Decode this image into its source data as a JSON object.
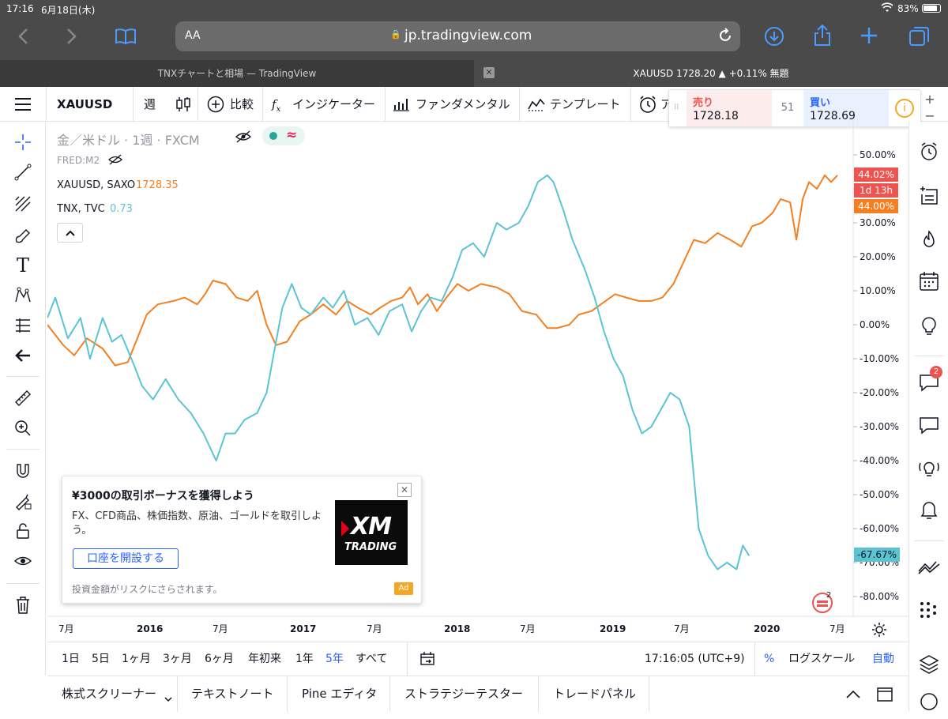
{
  "status": {
    "time": "17:16",
    "date": "6月18日(木)",
    "battery": "83%"
  },
  "browser": {
    "aa": "AA",
    "url": "jp.tradingview.com"
  },
  "tabs": [
    {
      "label": "TNXチャートと相場 — TradingView"
    },
    {
      "label": "XAUUSD 1728.20 ▲ +0.11% 無題"
    }
  ],
  "toolbar": {
    "symbol": "XAUUSD",
    "interval": "週",
    "compare": "比較",
    "indicators": "インジケーター",
    "fundamentals": "ファンダメンタル",
    "templates": "テンプレート",
    "alert": "ア"
  },
  "trade": {
    "sell_label": "売り",
    "sell_price": "1728.18",
    "spread": "51",
    "buy_label": "買い",
    "buy_price": "1728.69"
  },
  "legend": {
    "title": "金／米ドル · 1週 · FXCM",
    "fred": "FRED:M2",
    "xau_name": "XAUUSD, SAXO",
    "xau_value": "1728.35",
    "tnx_name": "TNX, TVC",
    "tnx_value": "0.73"
  },
  "badges": {
    "gold_pct": "44.02%",
    "countdown": "1d 13h",
    "gold_pct2": "44.00%",
    "tnx_pct": "-67.67%"
  },
  "ad": {
    "title": "¥3000の取引ボーナスを獲得しよう",
    "body": "FX、CFD商品、株価指数、原油、ゴールドを取引しよう。",
    "button": "口座を開設する",
    "risk": "投資金額がリスクにさらされます。",
    "tag": "Ad",
    "logo_top": "XM",
    "logo_bottom": "TRADING"
  },
  "ranges": [
    "1日",
    "5日",
    "1ヶ月",
    "3ヶ月",
    "6ヶ月",
    "年初来",
    "1年",
    "5年",
    "すべて"
  ],
  "bottom": {
    "clock": "17:16:05 (UTC+9)",
    "pct": "%",
    "log": "ログスケール",
    "auto": "自動"
  },
  "panel": [
    "株式スクリーナー",
    "テキストノート",
    "Pine エディタ",
    "ストラテジーテスター",
    "トレードパネル"
  ],
  "notif_count": "2",
  "colors": {
    "gold": "#f57f20",
    "tnx": "#5bc4d4",
    "up": "#ef5350",
    "blue": "#2962ff"
  },
  "chart_data": {
    "type": "line",
    "x_ticks": [
      "7月",
      "2016",
      "7月",
      "2017",
      "7月",
      "2018",
      "7月",
      "2019",
      "7月",
      "2020",
      "7月"
    ],
    "y_ticks": [
      "50.00%",
      "40.00%",
      "30.00%",
      "20.00%",
      "10.00%",
      "0.00%",
      "-10.00%",
      "-20.00%",
      "-30.00%",
      "-40.00%",
      "-50.00%",
      "-60.00%",
      "-70.00%",
      "-80.00%"
    ],
    "ylim": [
      -85,
      55
    ],
    "xlim": [
      2015.45,
      2020.55
    ],
    "series": [
      {
        "color": "#f57f20",
        "points": [
          [
            2015.45,
            0
          ],
          [
            2015.55,
            -6
          ],
          [
            2015.62,
            -9
          ],
          [
            2015.7,
            -4
          ],
          [
            2015.8,
            -7
          ],
          [
            2015.88,
            -12
          ],
          [
            2015.96,
            -11
          ],
          [
            2016.02,
            -4
          ],
          [
            2016.08,
            3
          ],
          [
            2016.15,
            6
          ],
          [
            2016.25,
            7
          ],
          [
            2016.32,
            8
          ],
          [
            2016.4,
            6
          ],
          [
            2016.45,
            9
          ],
          [
            2016.5,
            13
          ],
          [
            2016.58,
            12
          ],
          [
            2016.65,
            8
          ],
          [
            2016.72,
            7
          ],
          [
            2016.78,
            10
          ],
          [
            2016.84,
            0
          ],
          [
            2016.9,
            -6
          ],
          [
            2016.97,
            -5
          ],
          [
            2017.05,
            1
          ],
          [
            2017.12,
            3
          ],
          [
            2017.2,
            6
          ],
          [
            2017.28,
            3
          ],
          [
            2017.35,
            7
          ],
          [
            2017.42,
            5
          ],
          [
            2017.5,
            3
          ],
          [
            2017.56,
            5
          ],
          [
            2017.63,
            7
          ],
          [
            2017.7,
            8
          ],
          [
            2017.75,
            11
          ],
          [
            2017.8,
            6
          ],
          [
            2017.86,
            9
          ],
          [
            2017.92,
            4
          ],
          [
            2017.98,
            8
          ],
          [
            2018.05,
            12
          ],
          [
            2018.12,
            10
          ],
          [
            2018.2,
            12
          ],
          [
            2018.3,
            11
          ],
          [
            2018.38,
            9
          ],
          [
            2018.46,
            4
          ],
          [
            2018.55,
            3
          ],
          [
            2018.62,
            -1
          ],
          [
            2018.68,
            -1
          ],
          [
            2018.76,
            0
          ],
          [
            2018.82,
            3
          ],
          [
            2018.9,
            4
          ],
          [
            2018.96,
            6
          ],
          [
            2019.05,
            9
          ],
          [
            2019.12,
            8
          ],
          [
            2019.2,
            7
          ],
          [
            2019.28,
            7
          ],
          [
            2019.35,
            8
          ],
          [
            2019.42,
            12
          ],
          [
            2019.48,
            18
          ],
          [
            2019.55,
            25
          ],
          [
            2019.62,
            24
          ],
          [
            2019.7,
            27
          ],
          [
            2019.78,
            25
          ],
          [
            2019.85,
            23
          ],
          [
            2019.92,
            29
          ],
          [
            2019.98,
            30
          ],
          [
            2020.05,
            33
          ],
          [
            2020.1,
            37
          ],
          [
            2020.16,
            36
          ],
          [
            2020.2,
            25
          ],
          [
            2020.24,
            37
          ],
          [
            2020.28,
            42
          ],
          [
            2020.33,
            40
          ],
          [
            2020.38,
            44
          ],
          [
            2020.42,
            42
          ],
          [
            2020.46,
            44
          ]
        ]
      },
      {
        "color": "#5bc4d4",
        "points": [
          [
            2015.45,
            2
          ],
          [
            2015.5,
            8
          ],
          [
            2015.58,
            -4
          ],
          [
            2015.66,
            2
          ],
          [
            2015.72,
            -10
          ],
          [
            2015.8,
            2
          ],
          [
            2015.86,
            -5
          ],
          [
            2015.92,
            -3
          ],
          [
            2016.0,
            -12
          ],
          [
            2016.05,
            -18
          ],
          [
            2016.12,
            -22
          ],
          [
            2016.2,
            -16
          ],
          [
            2016.28,
            -22
          ],
          [
            2016.36,
            -26
          ],
          [
            2016.44,
            -32
          ],
          [
            2016.52,
            -40
          ],
          [
            2016.58,
            -32
          ],
          [
            2016.64,
            -32
          ],
          [
            2016.7,
            -28
          ],
          [
            2016.78,
            -26
          ],
          [
            2016.84,
            -20
          ],
          [
            2016.88,
            -10
          ],
          [
            2016.94,
            5
          ],
          [
            2017.0,
            12
          ],
          [
            2017.06,
            5
          ],
          [
            2017.12,
            3
          ],
          [
            2017.2,
            8
          ],
          [
            2017.26,
            5
          ],
          [
            2017.33,
            10
          ],
          [
            2017.4,
            0
          ],
          [
            2017.48,
            2
          ],
          [
            2017.55,
            -3
          ],
          [
            2017.62,
            4
          ],
          [
            2017.7,
            6
          ],
          [
            2017.76,
            -2
          ],
          [
            2017.82,
            4
          ],
          [
            2017.88,
            8
          ],
          [
            2017.95,
            7
          ],
          [
            2018.02,
            14
          ],
          [
            2018.08,
            22
          ],
          [
            2018.15,
            24
          ],
          [
            2018.22,
            20
          ],
          [
            2018.3,
            30
          ],
          [
            2018.36,
            28
          ],
          [
            2018.44,
            30
          ],
          [
            2018.5,
            35
          ],
          [
            2018.56,
            42
          ],
          [
            2018.62,
            44
          ],
          [
            2018.66,
            42
          ],
          [
            2018.72,
            34
          ],
          [
            2018.78,
            25
          ],
          [
            2018.86,
            16
          ],
          [
            2018.92,
            8
          ],
          [
            2018.98,
            -2
          ],
          [
            2019.04,
            -10
          ],
          [
            2019.1,
            -15
          ],
          [
            2019.16,
            -25
          ],
          [
            2019.22,
            -32
          ],
          [
            2019.28,
            -30
          ],
          [
            2019.34,
            -25
          ],
          [
            2019.4,
            -20
          ],
          [
            2019.46,
            -22
          ],
          [
            2019.52,
            -30
          ],
          [
            2019.58,
            -60
          ],
          [
            2019.64,
            -68
          ],
          [
            2019.7,
            -72
          ],
          [
            2019.76,
            -70
          ],
          [
            2019.82,
            -72
          ],
          [
            2019.86,
            -65
          ],
          [
            2019.9,
            -68
          ]
        ]
      }
    ],
    "note": "Chart-only line markup; interface shown above."
  }
}
